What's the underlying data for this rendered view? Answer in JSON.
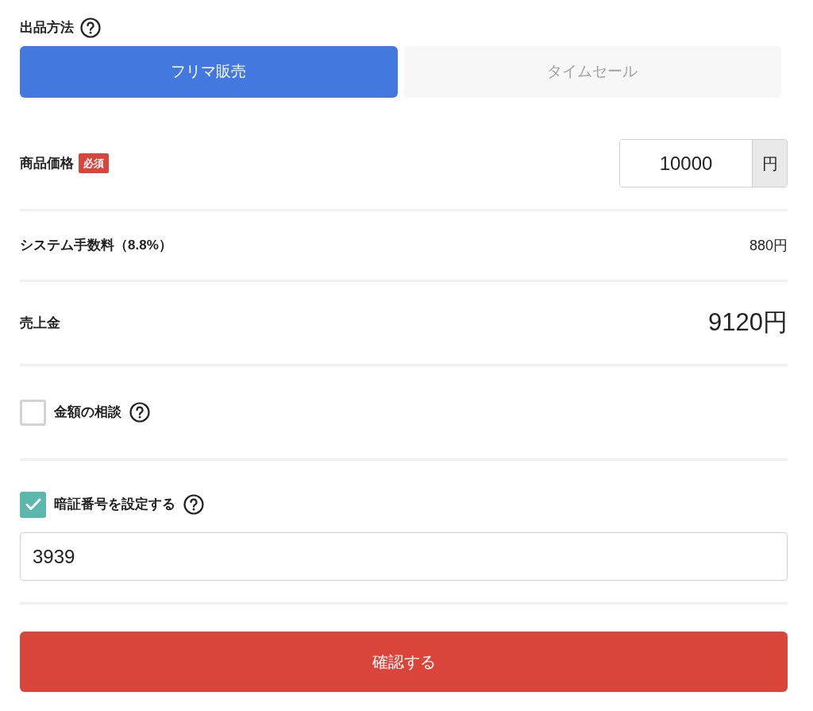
{
  "listing_method": {
    "label": "出品方法",
    "options": [
      {
        "label": "フリマ販売",
        "selected": true
      },
      {
        "label": "タイムセール",
        "selected": false
      }
    ]
  },
  "price": {
    "label": "商品価格",
    "badge": "必須",
    "value": "10000",
    "unit": "円"
  },
  "fee": {
    "label": "システム手数料（8.8%）",
    "value": "880円"
  },
  "proceeds": {
    "label": "売上金",
    "value": "9120円"
  },
  "negotiation": {
    "label": "金額の相談",
    "checked": false
  },
  "pin": {
    "label": "暗証番号を設定する",
    "checked": true,
    "value": "3939"
  },
  "confirm_button": "確認する"
}
